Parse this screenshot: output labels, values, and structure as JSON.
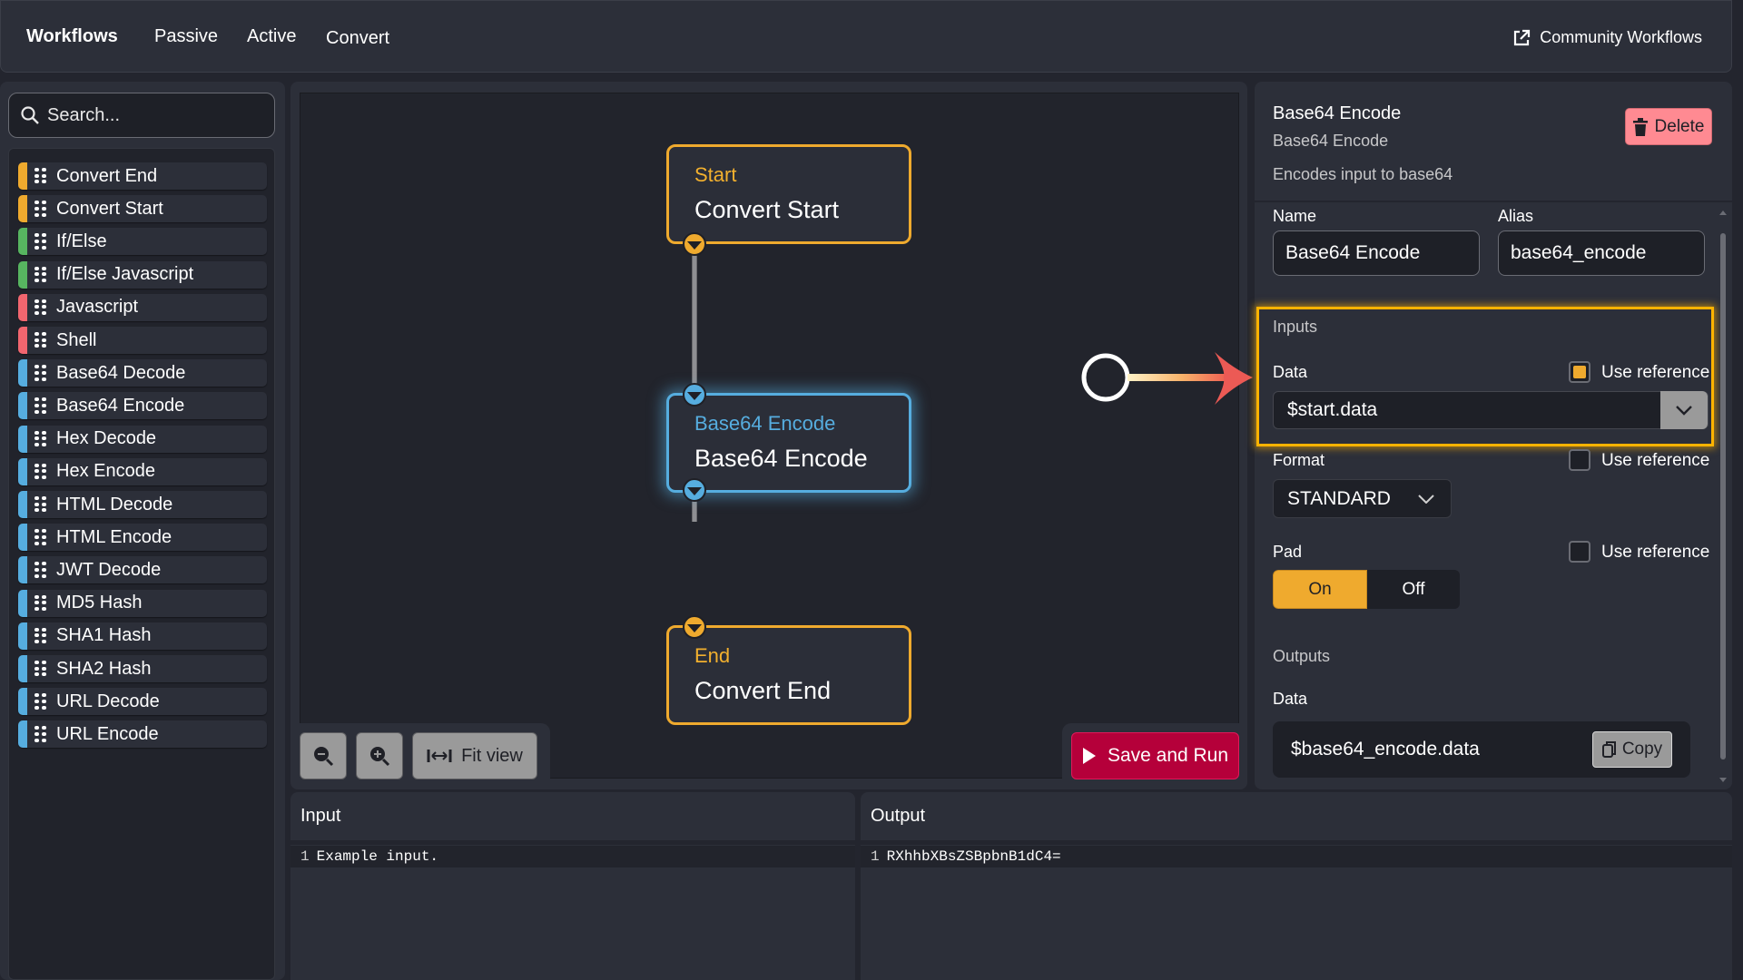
{
  "header": {
    "brand": "Workflows",
    "nav": [
      "Passive",
      "Active",
      "Convert"
    ],
    "community_link": "Community Workflows",
    "community_icon": "external-link-icon"
  },
  "sidebar": {
    "search_placeholder": "Search...",
    "items": [
      {
        "label": "Convert End",
        "color": "#efaa2e"
      },
      {
        "label": "Convert Start",
        "color": "#efaa2e"
      },
      {
        "label": "If/Else",
        "color": "#57b560"
      },
      {
        "label": "If/Else Javascript",
        "color": "#57b560"
      },
      {
        "label": "Javascript",
        "color": "#f2666f"
      },
      {
        "label": "Shell",
        "color": "#f2666f"
      },
      {
        "label": "Base64 Decode",
        "color": "#56addf"
      },
      {
        "label": "Base64 Encode",
        "color": "#56addf"
      },
      {
        "label": "Hex Decode",
        "color": "#56addf"
      },
      {
        "label": "Hex Encode",
        "color": "#56addf"
      },
      {
        "label": "HTML Decode",
        "color": "#56addf"
      },
      {
        "label": "HTML Encode",
        "color": "#56addf"
      },
      {
        "label": "JWT Decode",
        "color": "#56addf"
      },
      {
        "label": "MD5 Hash",
        "color": "#56addf"
      },
      {
        "label": "SHA1 Hash",
        "color": "#56addf"
      },
      {
        "label": "SHA2 Hash",
        "color": "#56addf"
      },
      {
        "label": "URL Decode",
        "color": "#56addf"
      },
      {
        "label": "URL Encode",
        "color": "#56addf"
      }
    ]
  },
  "canvas": {
    "nodes": [
      {
        "type": "Start",
        "title": "Convert Start"
      },
      {
        "type": "Base64 Encode",
        "title": "Base64 Encode",
        "selected": true
      },
      {
        "type": "End",
        "title": "Convert End"
      }
    ],
    "controls": {
      "zoom_out_icon": "zoom-out-icon",
      "zoom_in_icon": "zoom-in-icon",
      "fit_view_label": "Fit view"
    },
    "save_run_label": "Save and Run"
  },
  "properties": {
    "title": "Base64 Encode",
    "subtitle": "Base64 Encode",
    "description": "Encodes input to base64",
    "delete_label": "Delete",
    "name_label": "Name",
    "name_value": "Base64 Encode",
    "alias_label": "Alias",
    "alias_value": "base64_encode",
    "inputs_label": "Inputs",
    "data_label": "Data",
    "use_reference_label": "Use reference",
    "data_use_reference": true,
    "data_value": "$start.data",
    "format_label": "Format",
    "format_use_reference": false,
    "format_value": "STANDARD",
    "pad_label": "Pad",
    "pad_use_reference": false,
    "pad_on_label": "On",
    "pad_off_label": "Off",
    "pad_value": "On",
    "outputs_label": "Outputs",
    "output_data_label": "Data",
    "output_data_value": "$base64_encode.data",
    "copy_label": "Copy"
  },
  "io": {
    "input_title": "Input",
    "input_lines": [
      {
        "n": "1",
        "text": "Example input."
      }
    ],
    "output_title": "Output",
    "output_lines": [
      {
        "n": "1",
        "text": "RXhhbXBsZSBpbnB1dC4="
      }
    ]
  },
  "colors": {
    "accent_orange": "#efaa2e",
    "accent_blue": "#56addf",
    "danger": "#b5003a",
    "delete_bg": "#ff8a92",
    "highlight": "#ffb300"
  }
}
